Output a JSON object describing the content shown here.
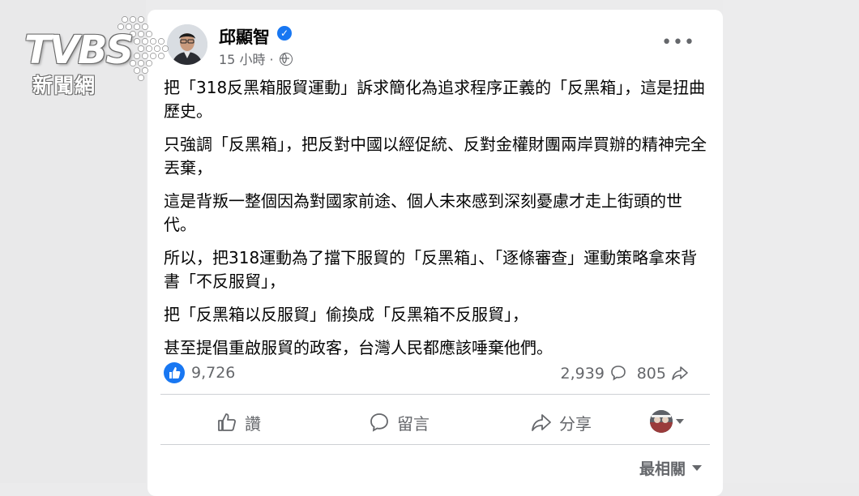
{
  "watermark": {
    "brand": "TVBS",
    "sub": "新聞網"
  },
  "post": {
    "author": "邱顯智",
    "time": "15 小時",
    "separator": "·",
    "paragraphs": [
      "把「318反黑箱服貿運動」訴求簡化為追求程序正義的「反黑箱」，這是扭曲歷史。",
      "只強調「反黑箱」，把反對中國以經促統、反對金權財團兩岸買辦的精神完全丟棄，",
      "這是背叛一整個因為對國家前途、個人未來感到深刻憂慮才走上街頭的世代。",
      "所以，把318運動為了擋下服貿的「反黑箱」、「逐條審查」運動策略拿來背書「不反服貿」，",
      "把「反黑箱以反服貿」偷換成「反黑箱不反服貿」，",
      "甚至提倡重啟服貿的政客，台灣人民都應該唾棄他們。"
    ],
    "reactions": {
      "likes": "9,726",
      "comments": "2,939",
      "shares": "805"
    },
    "actions": {
      "like": "讚",
      "comment": "留言",
      "share": "分享"
    },
    "sort": "最相關"
  },
  "colors": {
    "accent": "#1877f2",
    "muted": "#65676b"
  }
}
